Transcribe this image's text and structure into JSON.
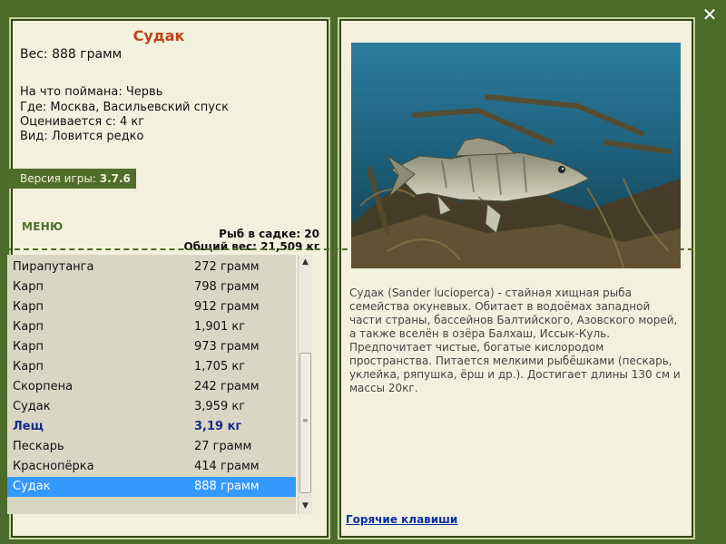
{
  "fish": {
    "title": "Судак",
    "weight": "Вес: 888 грамм",
    "bait": "На что поймана: Червь",
    "location": "Где: Москва, Васильевский спуск",
    "value": "Оценивается с: 4 кг",
    "rarity": "Вид: Ловится редко"
  },
  "version": {
    "label": "Версия игры:",
    "value": "3.7.6"
  },
  "menu_label": "МЕНЮ",
  "stats": {
    "fish_in_cage": "Рыб в садке: 20",
    "total_weight": "Общий вес: 21,509 кг"
  },
  "catch_list": [
    {
      "name": "Пирапутанга",
      "weight": "272 грамм"
    },
    {
      "name": "Карп",
      "weight": "798 грамм"
    },
    {
      "name": "Карп",
      "weight": "912 грамм"
    },
    {
      "name": "Карп",
      "weight": "1,901 кг"
    },
    {
      "name": "Карп",
      "weight": "973 грамм"
    },
    {
      "name": "Карп",
      "weight": "1,705 кг"
    },
    {
      "name": "Скорпена",
      "weight": "242 грамм"
    },
    {
      "name": "Судак",
      "weight": "3,959 кг"
    },
    {
      "name": "Лещ",
      "weight": "3,19 кг"
    },
    {
      "name": "Пескарь",
      "weight": "27 грамм"
    },
    {
      "name": "Краснопёрка",
      "weight": "414 грамм"
    },
    {
      "name": "Судак",
      "weight": "888 грамм"
    }
  ],
  "description": "Судак (Sander lucioperca) - стайная хищная рыба семейства окуневых. Обитает в водоёмах западной части страны, бассейнов Балтийского, Азовского морей, а также вселён в озёра Балхаш, Иссык-Куль. Предпочитает чистые, богатые кислородом пространства. Питается мелкими рыбёшками (пескарь, уклейка, ряпушка, ёрш и др.). Достигает длины 130 см и массы 20кг.",
  "hotkeys_label": "Горячие клавиши",
  "colors": {
    "background": "#4a6b2a",
    "panel": "#f3f1dd",
    "accent": "#4f6e2b",
    "title": "#c0421a",
    "selection": "#3399ff"
  }
}
